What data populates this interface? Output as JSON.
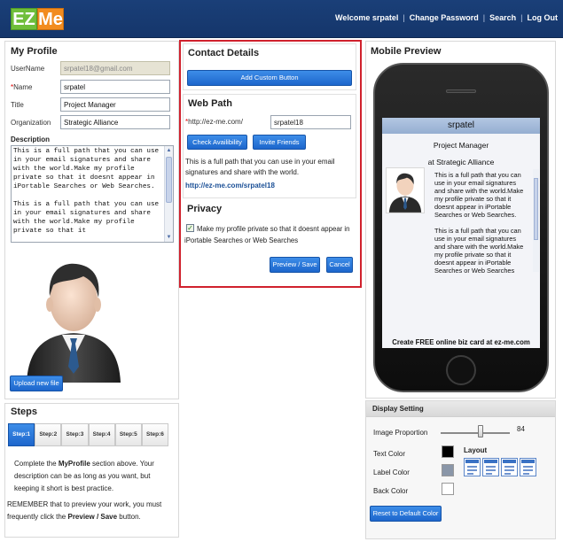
{
  "header": {
    "logo": "EZMe",
    "nav": [
      "Welcome srpatel",
      "Change Password",
      "Search",
      "Log Out"
    ]
  },
  "profile": {
    "title": "My Profile",
    "fields": [
      {
        "label": "UserName",
        "value": "srpatel18@gmail.com",
        "required": false,
        "disabled": true
      },
      {
        "label": "Name",
        "value": "srpatel",
        "required": true,
        "disabled": false
      },
      {
        "label": "Title",
        "value": "Project Manager",
        "required": false,
        "disabled": false
      },
      {
        "label": "Organization",
        "value": "Strategic Alliance",
        "required": false,
        "disabled": false
      }
    ],
    "description_label": "Description",
    "description": "This is a full path that you can use in your email signatures and share with the world.Make my profile private so that it doesnt appear in iPortable Searches or Web Searches.\n\nThis is a full path that you can use in your email signatures and share with the world.Make my profile private so that it",
    "upload_button": "Upload new file"
  },
  "steps": {
    "title": "Steps",
    "tabs": [
      "Step:1",
      "Step:2",
      "Step:3",
      "Step:4",
      "Step:5",
      "Step:6"
    ],
    "active": 0,
    "text1_a": "Complete the ",
    "text1_b": "MyProfile",
    "text1_c": " section above. Your description can be as long as you want, but keeping it short is best practice.",
    "text2_a": "REMEMBER that to preview your work, you must frequently click the ",
    "text2_b": "Preview / Save",
    "text2_c": " button."
  },
  "contact": {
    "title": "Contact Details",
    "add_button": "Add Custom Button"
  },
  "webpath": {
    "title": "Web Path",
    "url_prefix": "http://ez-me.com/",
    "slug": "srpatel18",
    "check_button": "Check Availibility",
    "invite_button": "Invite Friends",
    "text": "This is a full path that you can use in your email signatures and share with the world.",
    "link": "http://ez-me.com/srpatel18"
  },
  "privacy": {
    "title": "Privacy",
    "checked": true,
    "text": "Make my profile private so that it doesnt appear in iPortable Searches or Web Searches",
    "preview_button": "Preview / Save",
    "cancel_button": "Cancel"
  },
  "mobile": {
    "title": "Mobile Preview",
    "name": "srpatel",
    "job_title": "Project Manager",
    "company": "at Strategic Alliance",
    "description": "This is a full path that you can use in your email signatures and share with the world.Make my profile private so that it doesnt appear in iPortable Searches or Web Searches.\n\nThis is a full path that you can use in your email signatures and share with the world.Make my profile private so that it doesnt appear in iPortable Searches or Web Searches",
    "footer": "Create FREE online biz card at ez-me.com"
  },
  "display": {
    "title": "Display Setting",
    "image_proportion_label": "Image Proportion",
    "image_proportion_value": "84",
    "text_color_label": "Text Color",
    "label_color_label": "Label Color",
    "back_color_label": "Back Color",
    "layout_label": "Layout",
    "reset_button": "Reset to Default Color",
    "colors": {
      "text": "#000000",
      "label": "#8a96a8",
      "back": "#ffffff",
      "accent": "#1d66cc",
      "header": "#1a3f78"
    }
  }
}
